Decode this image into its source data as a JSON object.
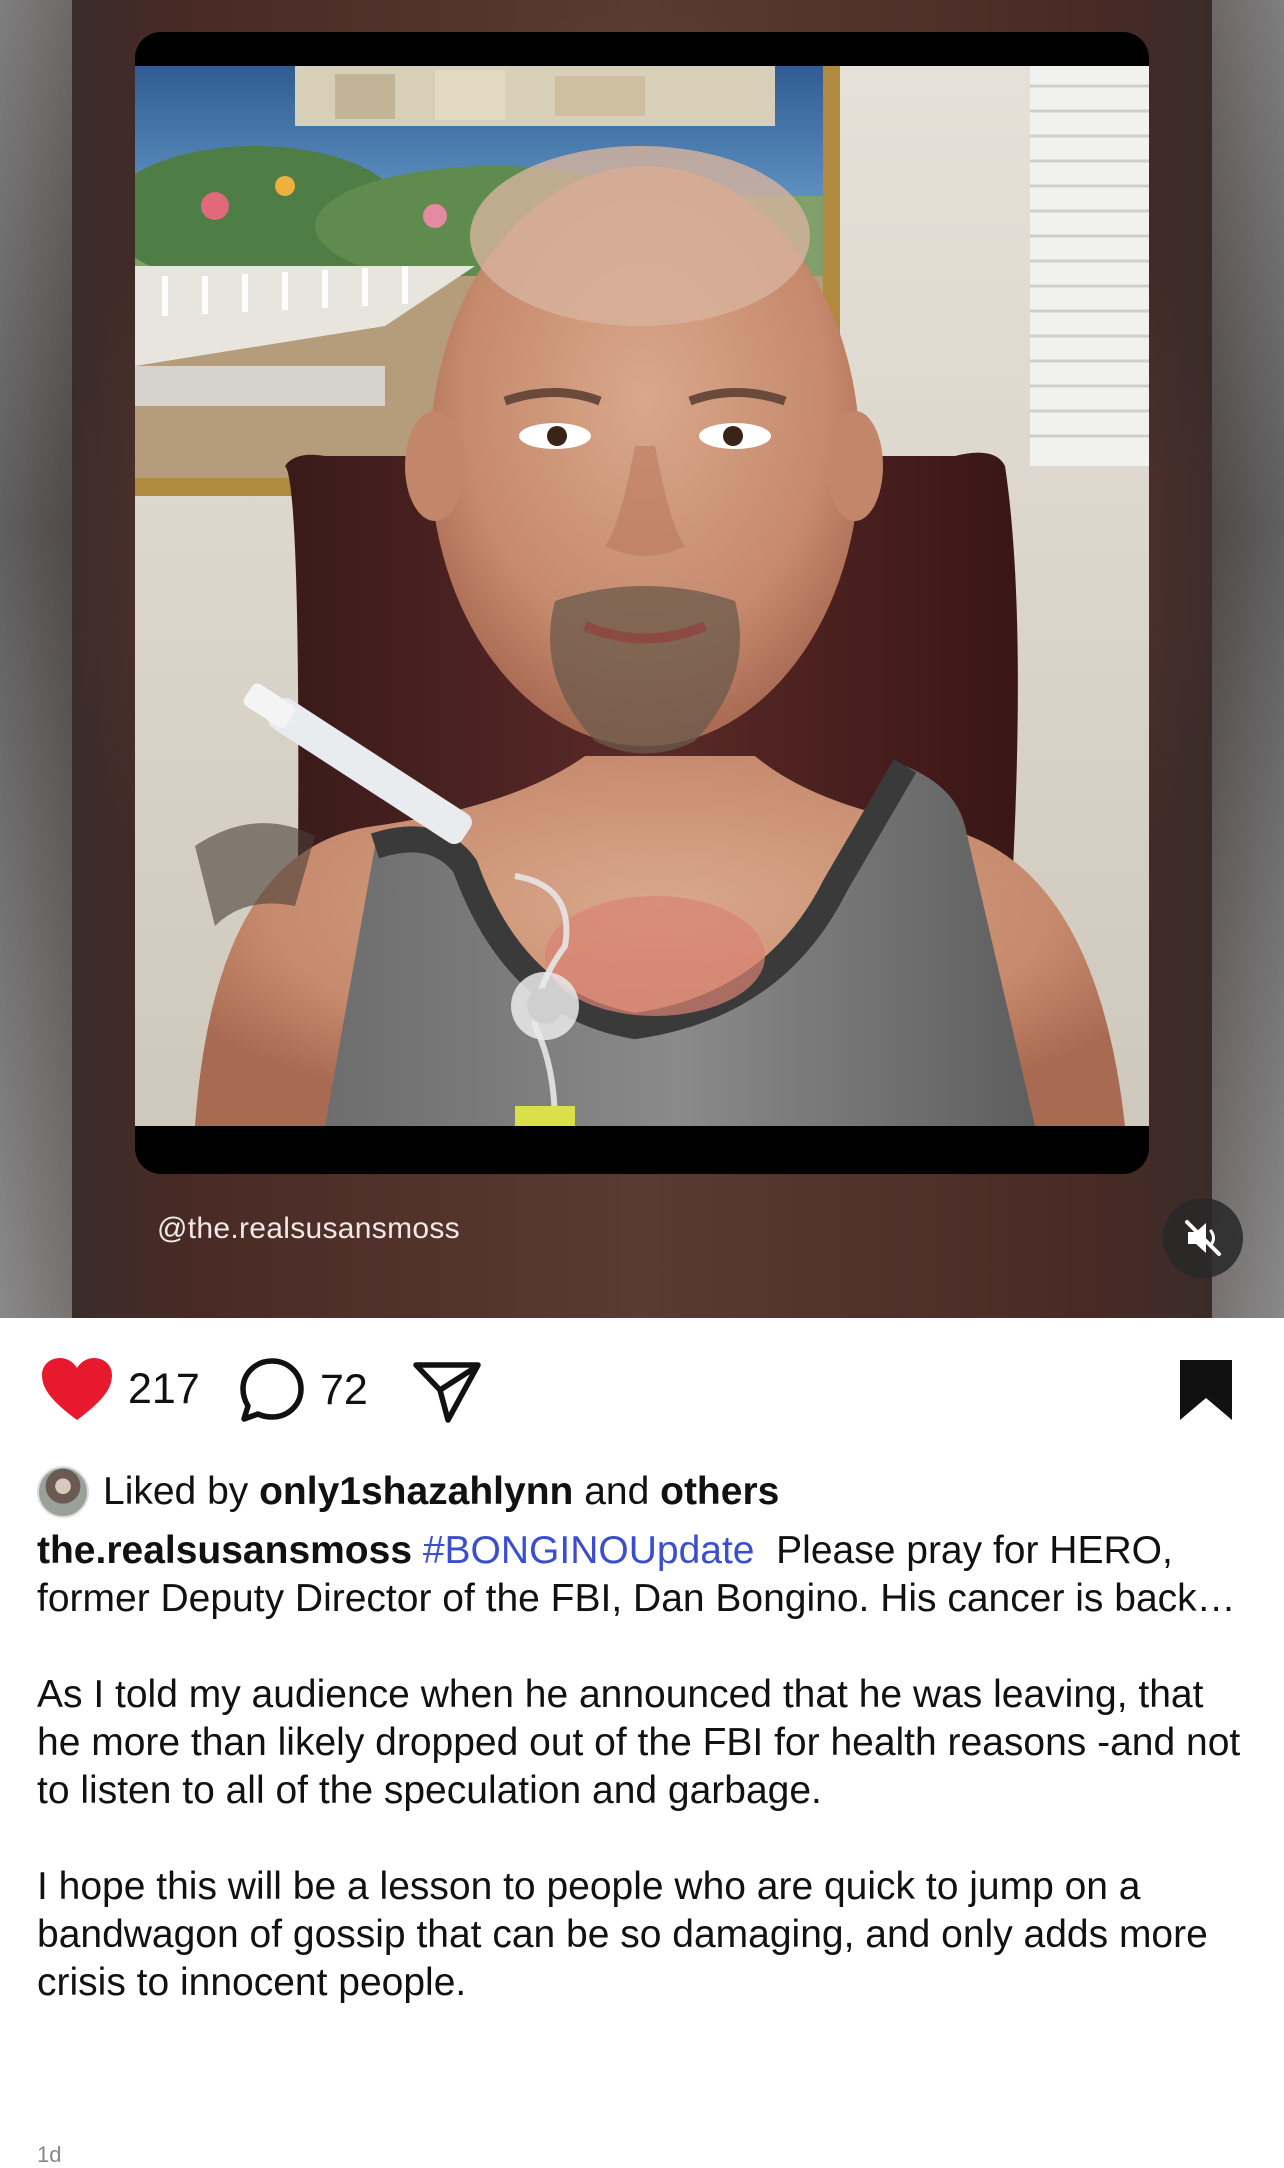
{
  "media": {
    "overlay_handle": "@the.realsusansmoss",
    "mute_icon": "speaker-muted-icon"
  },
  "actions": {
    "like_count": "217",
    "comment_count": "72",
    "like_icon": "heart-filled-icon",
    "comment_icon": "speech-bubble-icon",
    "share_icon": "paper-plane-icon",
    "bookmark_icon": "bookmark-filled-icon",
    "like_color": "#e8192c"
  },
  "liked_by": {
    "prefix": "Liked by",
    "user": "only1shazahlynn",
    "conjunction": "and",
    "others": "others"
  },
  "caption": {
    "username": "the.realsusansmoss",
    "hashtag": "#BONGINOUpdate",
    "hashtag_color": "#3a4fd0",
    "text_1": "Please pray for HERO, former Deputy Director of the FBI, Dan Bongino.  His cancer is back…",
    "paragraph_2": "As I told my audience when he announced that he was leaving, that he more than likely dropped out of the FBI for health reasons -and not to listen to all of the speculation and garbage.",
    "paragraph_3": "I hope this will be a lesson to people who are quick to jump on a bandwagon of gossip that can be so damaging, and only adds more crisis to innocent people."
  },
  "timestamp": "1d"
}
